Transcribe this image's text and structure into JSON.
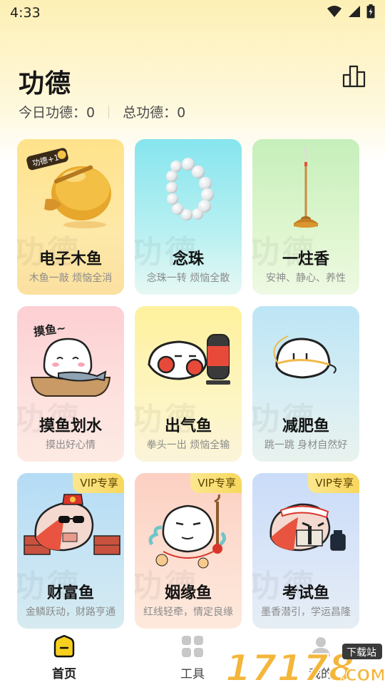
{
  "status_bar": {
    "time": "4:33"
  },
  "header": {
    "title": "功德",
    "today_label": "今日功德：0",
    "total_label": "总功德：0"
  },
  "cards": [
    {
      "title": "电子木鱼",
      "subtitle": "木鱼一敲  烦恼全消",
      "badge": "",
      "art_text": "功德+1"
    },
    {
      "title": "念珠",
      "subtitle": "念珠一转  烦恼全散",
      "badge": ""
    },
    {
      "title": "一炷香",
      "subtitle": "安神、静心、养性",
      "badge": ""
    },
    {
      "title": "摸鱼划水",
      "subtitle": "摸出好心情",
      "badge": "",
      "art_text": "摸鱼~"
    },
    {
      "title": "出气鱼",
      "subtitle": "拳头一出 烦恼全输",
      "badge": ""
    },
    {
      "title": "减肥鱼",
      "subtitle": "跳一跳 身材自然好",
      "badge": ""
    },
    {
      "title": "财富鱼",
      "subtitle": "金鳞跃动，财路亨通",
      "badge": "VIP专享"
    },
    {
      "title": "姻缘鱼",
      "subtitle": "红线轻牵，情定良缘",
      "badge": "VIP专享"
    },
    {
      "title": "考试鱼",
      "subtitle": "墨香潜引，学运昌隆",
      "badge": "VIP专享"
    }
  ],
  "card_watermark": "功德",
  "bottom_nav": {
    "items": [
      {
        "label": "首页",
        "icon": "home-icon",
        "active": true
      },
      {
        "label": "工具",
        "icon": "grid-icon",
        "active": false
      },
      {
        "label": "我的",
        "icon": "profile-icon",
        "active": false
      }
    ]
  },
  "watermark_logo": {
    "number": "17178",
    "tag": "下载站",
    "suffix": ".COM"
  },
  "colors": {
    "accent": "#f7cf1e",
    "title": "#161616",
    "subtitle": "#8b8b8b",
    "vip_bg": "#f8d75d"
  }
}
